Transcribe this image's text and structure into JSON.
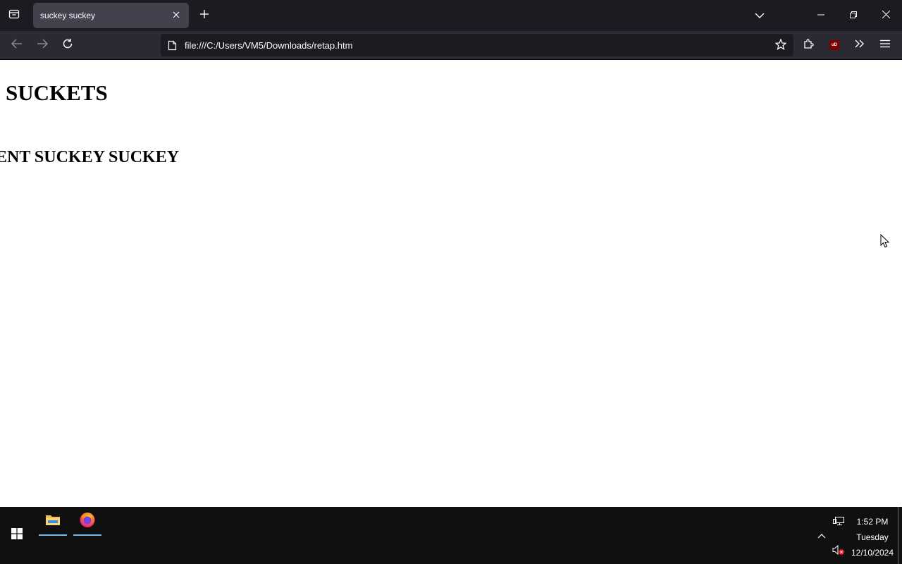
{
  "browser": {
    "tab": {
      "title": "suckey suckey"
    },
    "url": "file:///C:/Users/VM5/Downloads/retap.htm"
  },
  "page": {
    "heading1": "SUCKETS",
    "heading2": "ENT SUCKEY SUCKEY"
  },
  "taskbar": {
    "apps": [
      "file-explorer-icon",
      "firefox-icon"
    ],
    "clock": {
      "time": "1:52 PM",
      "day": "Tuesday",
      "date": "12/10/2024"
    }
  },
  "colors": {
    "tabstrip_bg": "#1c1b22",
    "toolbar_bg": "#2b2a33",
    "active_tab_bg": "#42414d",
    "taskbar_bg": "#101010",
    "taskbar_underline": "#76b9ed"
  }
}
